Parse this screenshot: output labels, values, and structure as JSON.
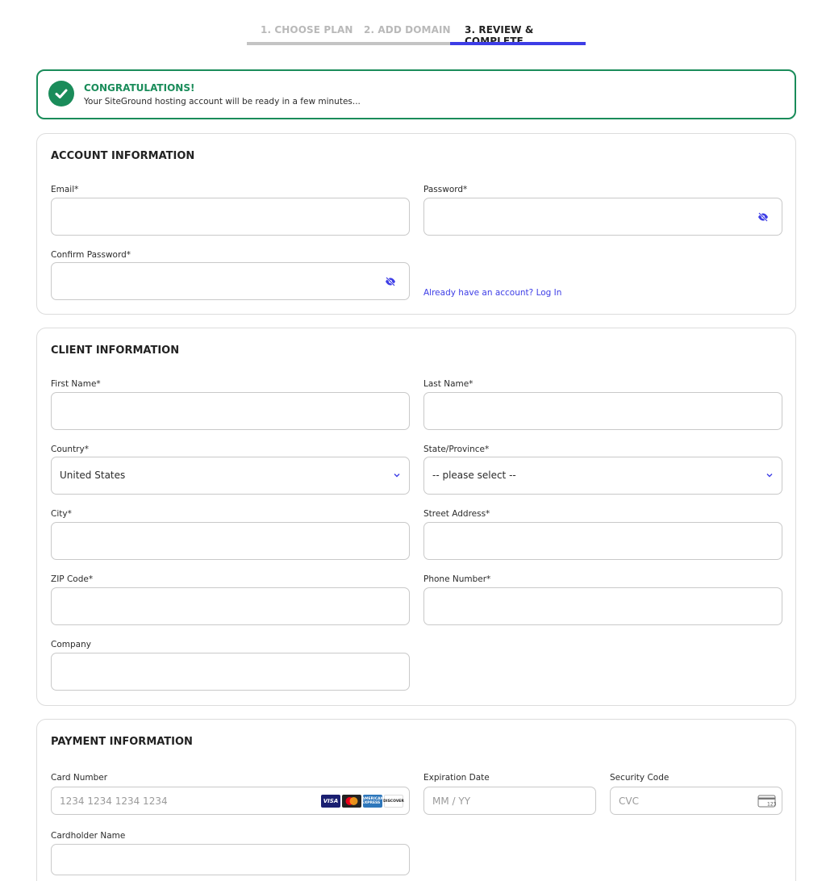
{
  "steps": [
    {
      "label": "1. CHOOSE PLAN",
      "state": "done"
    },
    {
      "label": "2. ADD DOMAIN",
      "state": "done"
    },
    {
      "label": "3. REVIEW & COMPLETE",
      "state": "active"
    }
  ],
  "banner": {
    "title": "CONGRATULATIONS!",
    "message": "Your SiteGround hosting account will be ready in a few minutes...",
    "icon": "check-circle-icon"
  },
  "account": {
    "title": "ACCOUNT INFORMATION",
    "email_label": "Email*",
    "email_value": "",
    "password_label": "Password*",
    "password_value": "",
    "confirm_label": "Confirm Password*",
    "confirm_value": "",
    "login_link": "Already have an account? Log In"
  },
  "client": {
    "title": "CLIENT INFORMATION",
    "first_name_label": "First Name*",
    "last_name_label": "Last Name*",
    "country_label": "Country*",
    "country_value": "United States",
    "state_label": "State/Province*",
    "state_value": "-- please select --",
    "city_label": "City*",
    "street_label": "Street Address*",
    "zip_label": "ZIP Code*",
    "phone_label": "Phone Number*",
    "company_label": "Company"
  },
  "payment": {
    "title": "PAYMENT INFORMATION",
    "card_label": "Card Number",
    "card_placeholder": "1234 1234 1234 1234",
    "card_logos": [
      "VISA",
      "",
      "AMERICAN EXPRESS",
      "DISCOVER"
    ],
    "exp_label": "Expiration Date",
    "exp_placeholder": "MM / YY",
    "cvc_label": "Security Code",
    "cvc_placeholder": "CVC",
    "cvc_icon_text": "123",
    "holder_label": "Cardholder Name"
  },
  "colors": {
    "accent": "#3d3de6",
    "success": "#1a8c5a",
    "border": "#c9c9c9"
  }
}
